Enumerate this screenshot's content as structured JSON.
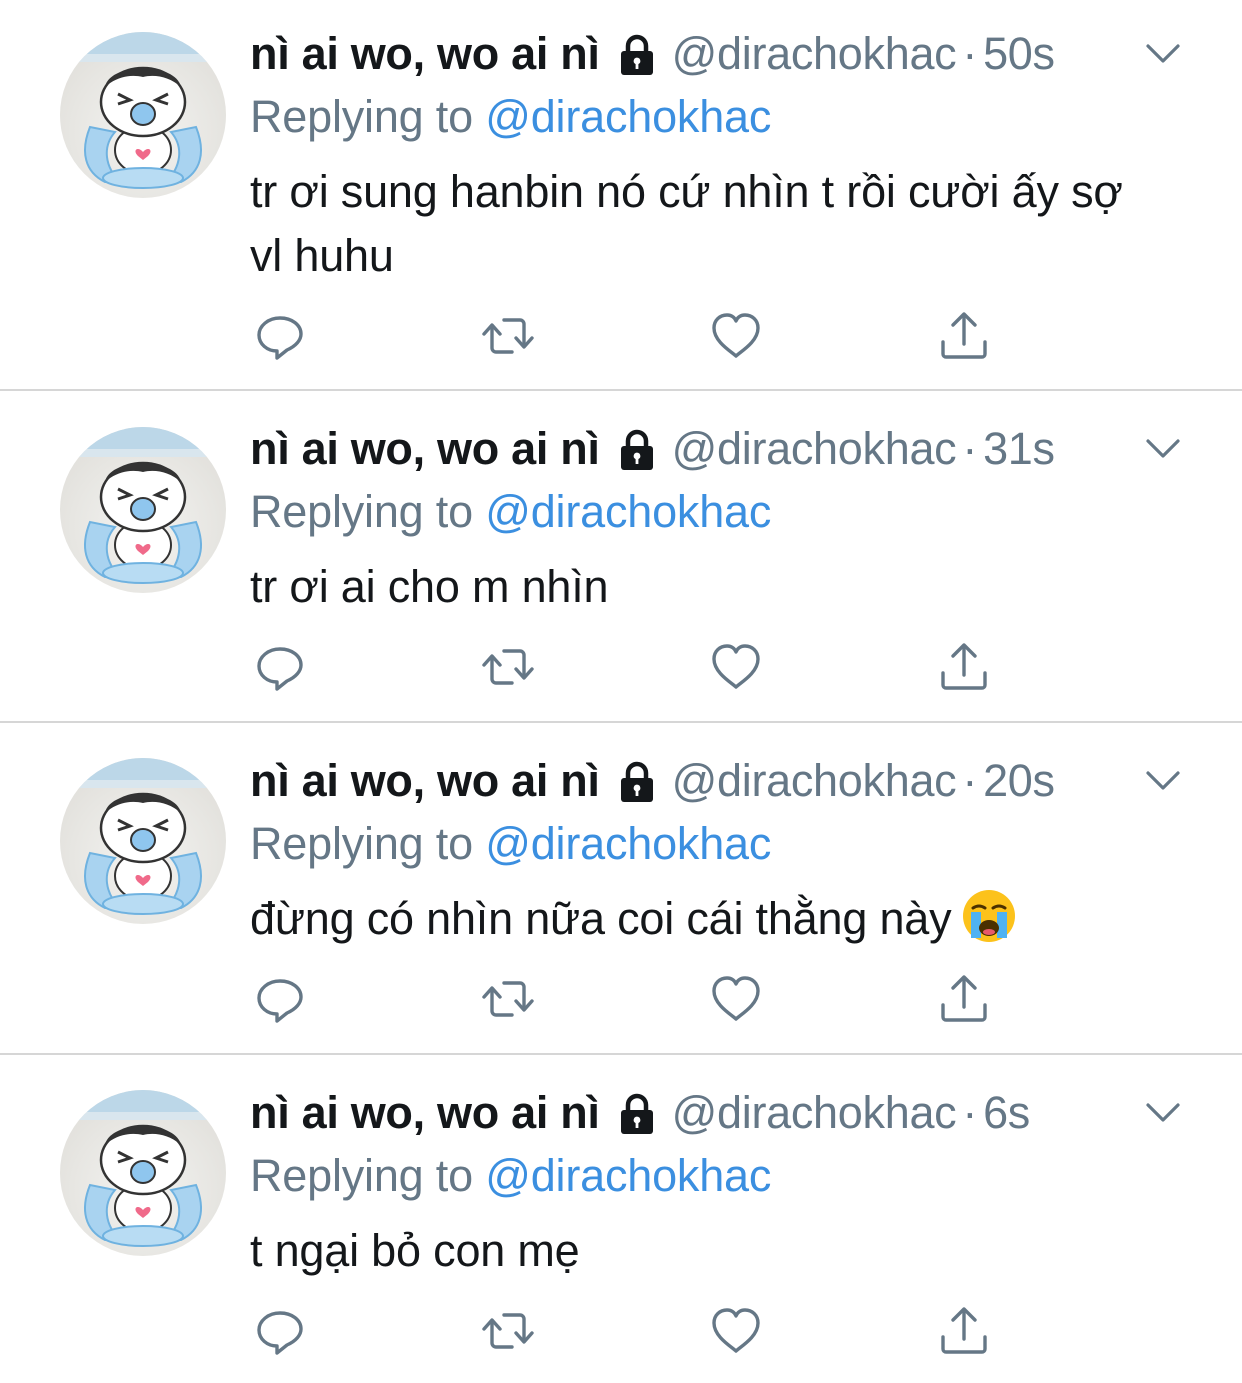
{
  "colors": {
    "text": "#14171a",
    "secondary": "#657786",
    "link": "#3b8fe0",
    "divider": "#d6d6d6"
  },
  "icons": {
    "lock": "lock-icon",
    "chevron": "chevron-down-icon",
    "reply": "reply-icon",
    "retweet": "retweet-icon",
    "like": "heart-icon",
    "share": "share-icon",
    "emoji": "loudly-crying-face-emoji"
  },
  "tweets": [
    {
      "name": "nì ai wo, wo ai nì",
      "handle": "@dirachokhac",
      "dot": "·",
      "time": "50s",
      "replying_label": "Replying to",
      "replying_to": "@dirachokhac",
      "text_line1": "tr ơi sung hanbin nó cứ nhìn t rồi cười ấy sợ",
      "text_line2": "vl huhu"
    },
    {
      "name": "nì ai wo, wo ai nì",
      "handle": "@dirachokhac",
      "dot": "·",
      "time": "31s",
      "replying_label": "Replying to",
      "replying_to": "@dirachokhac",
      "text_line1": "tr ơi ai cho m nhìn"
    },
    {
      "name": "nì ai wo, wo ai nì",
      "handle": "@dirachokhac",
      "dot": "·",
      "time": "20s",
      "replying_label": "Replying to",
      "replying_to": "@dirachokhac",
      "text_line1": "đừng có nhìn nữa coi cái thằng này",
      "emoji": "😭"
    },
    {
      "name": "nì ai wo, wo ai nì",
      "handle": "@dirachokhac",
      "dot": "·",
      "time": "6s",
      "replying_label": "Replying to",
      "replying_to": "@dirachokhac",
      "text_line1": "t ngại bỏ con mẹ"
    }
  ]
}
